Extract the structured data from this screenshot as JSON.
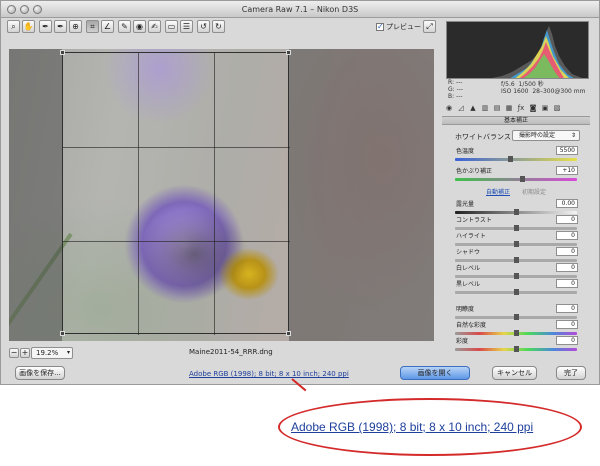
{
  "window": {
    "title": "Camera Raw 7.1  –  Nikon D3S"
  },
  "toolbar": {
    "tools": [
      "zoom-icon",
      "hand-icon",
      "white-balance-icon",
      "color-sampler-icon",
      "targeted-adjust-icon",
      "crop-icon",
      "straighten-icon",
      "spot-removal-icon",
      "red-eye-icon",
      "adjustment-brush-icon",
      "graduated-filter-icon",
      "preferences-icon",
      "rotate-ccw-icon",
      "rotate-cw-icon"
    ],
    "preview_label": "プレビュー",
    "preview_checked": true
  },
  "histogram": {
    "r_label": "R:",
    "g_label": "G:",
    "b_label": "B:",
    "r": "---",
    "g": "---",
    "b": "---",
    "aperture": "f/5.6",
    "shutter": "1/500 秒",
    "iso": "ISO 1600",
    "lens": "28–300@300 mm"
  },
  "panel": {
    "title": "基本補正",
    "white_balance_label": "ホワイトバランス：",
    "white_balance_value": "撮影時の設定",
    "sliders_top": [
      {
        "label": "色温度",
        "value": "5500",
        "pos": 0.45
      },
      {
        "label": "色かぶり補正",
        "value": "+10",
        "pos": 0.55
      }
    ],
    "auto_label": "自動補正",
    "default_label": "初期設定",
    "sliders_mid": [
      {
        "label": "露光量",
        "value": "0.00",
        "pos": 0.5
      },
      {
        "label": "コントラスト",
        "value": "0",
        "pos": 0.5
      },
      {
        "label": "ハイライト",
        "value": "0",
        "pos": 0.5
      },
      {
        "label": "シャドウ",
        "value": "0",
        "pos": 0.5
      },
      {
        "label": "白レベル",
        "value": "0",
        "pos": 0.5
      },
      {
        "label": "黒レベル",
        "value": "0",
        "pos": 0.5
      }
    ],
    "sliders_bottom": [
      {
        "label": "明瞭度",
        "value": "0",
        "pos": 0.5
      },
      {
        "label": "自然な彩度",
        "value": "0",
        "pos": 0.5
      },
      {
        "label": "彩度",
        "value": "0",
        "pos": 0.5
      }
    ]
  },
  "zoom": {
    "value": "19.2%",
    "minus": "−",
    "plus": "+"
  },
  "image": {
    "filename": "Maine2011-54_RRR.dng"
  },
  "bottom": {
    "save_button": "画像を保存...",
    "workflow_link": "Adobe RGB (1998); 8 bit; 8 x 10 inch; 240 ppi",
    "open_button": "画像を開く",
    "cancel_button": "キャンセル",
    "done_button": "完了"
  },
  "callout": {
    "text": "Adobe RGB (1998); 8 bit; 8 x 10 inch; 240 ppi"
  },
  "colors": {
    "accent": "#1e3f9b",
    "callout_red": "#d42a2a",
    "primary_button": "#5e97e6"
  }
}
